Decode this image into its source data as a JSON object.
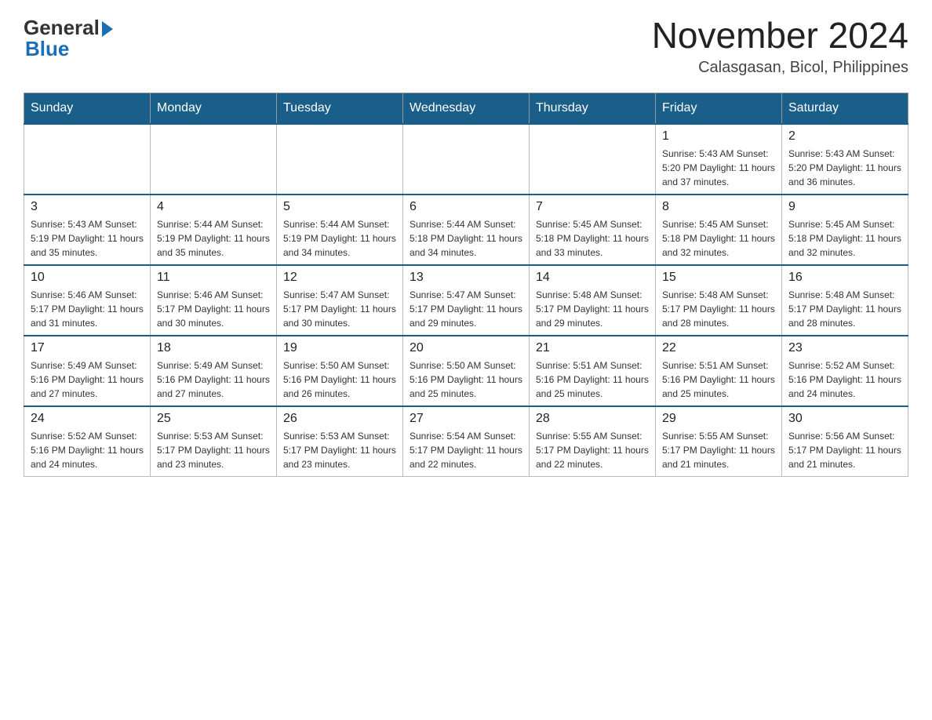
{
  "logo": {
    "general": "General",
    "blue": "Blue"
  },
  "title": "November 2024",
  "subtitle": "Calasgasan, Bicol, Philippines",
  "days_of_week": [
    "Sunday",
    "Monday",
    "Tuesday",
    "Wednesday",
    "Thursday",
    "Friday",
    "Saturday"
  ],
  "weeks": [
    [
      {
        "day": "",
        "info": ""
      },
      {
        "day": "",
        "info": ""
      },
      {
        "day": "",
        "info": ""
      },
      {
        "day": "",
        "info": ""
      },
      {
        "day": "",
        "info": ""
      },
      {
        "day": "1",
        "info": "Sunrise: 5:43 AM\nSunset: 5:20 PM\nDaylight: 11 hours and 37 minutes."
      },
      {
        "day": "2",
        "info": "Sunrise: 5:43 AM\nSunset: 5:20 PM\nDaylight: 11 hours and 36 minutes."
      }
    ],
    [
      {
        "day": "3",
        "info": "Sunrise: 5:43 AM\nSunset: 5:19 PM\nDaylight: 11 hours and 35 minutes."
      },
      {
        "day": "4",
        "info": "Sunrise: 5:44 AM\nSunset: 5:19 PM\nDaylight: 11 hours and 35 minutes."
      },
      {
        "day": "5",
        "info": "Sunrise: 5:44 AM\nSunset: 5:19 PM\nDaylight: 11 hours and 34 minutes."
      },
      {
        "day": "6",
        "info": "Sunrise: 5:44 AM\nSunset: 5:18 PM\nDaylight: 11 hours and 34 minutes."
      },
      {
        "day": "7",
        "info": "Sunrise: 5:45 AM\nSunset: 5:18 PM\nDaylight: 11 hours and 33 minutes."
      },
      {
        "day": "8",
        "info": "Sunrise: 5:45 AM\nSunset: 5:18 PM\nDaylight: 11 hours and 32 minutes."
      },
      {
        "day": "9",
        "info": "Sunrise: 5:45 AM\nSunset: 5:18 PM\nDaylight: 11 hours and 32 minutes."
      }
    ],
    [
      {
        "day": "10",
        "info": "Sunrise: 5:46 AM\nSunset: 5:17 PM\nDaylight: 11 hours and 31 minutes."
      },
      {
        "day": "11",
        "info": "Sunrise: 5:46 AM\nSunset: 5:17 PM\nDaylight: 11 hours and 30 minutes."
      },
      {
        "day": "12",
        "info": "Sunrise: 5:47 AM\nSunset: 5:17 PM\nDaylight: 11 hours and 30 minutes."
      },
      {
        "day": "13",
        "info": "Sunrise: 5:47 AM\nSunset: 5:17 PM\nDaylight: 11 hours and 29 minutes."
      },
      {
        "day": "14",
        "info": "Sunrise: 5:48 AM\nSunset: 5:17 PM\nDaylight: 11 hours and 29 minutes."
      },
      {
        "day": "15",
        "info": "Sunrise: 5:48 AM\nSunset: 5:17 PM\nDaylight: 11 hours and 28 minutes."
      },
      {
        "day": "16",
        "info": "Sunrise: 5:48 AM\nSunset: 5:17 PM\nDaylight: 11 hours and 28 minutes."
      }
    ],
    [
      {
        "day": "17",
        "info": "Sunrise: 5:49 AM\nSunset: 5:16 PM\nDaylight: 11 hours and 27 minutes."
      },
      {
        "day": "18",
        "info": "Sunrise: 5:49 AM\nSunset: 5:16 PM\nDaylight: 11 hours and 27 minutes."
      },
      {
        "day": "19",
        "info": "Sunrise: 5:50 AM\nSunset: 5:16 PM\nDaylight: 11 hours and 26 minutes."
      },
      {
        "day": "20",
        "info": "Sunrise: 5:50 AM\nSunset: 5:16 PM\nDaylight: 11 hours and 25 minutes."
      },
      {
        "day": "21",
        "info": "Sunrise: 5:51 AM\nSunset: 5:16 PM\nDaylight: 11 hours and 25 minutes."
      },
      {
        "day": "22",
        "info": "Sunrise: 5:51 AM\nSunset: 5:16 PM\nDaylight: 11 hours and 25 minutes."
      },
      {
        "day": "23",
        "info": "Sunrise: 5:52 AM\nSunset: 5:16 PM\nDaylight: 11 hours and 24 minutes."
      }
    ],
    [
      {
        "day": "24",
        "info": "Sunrise: 5:52 AM\nSunset: 5:16 PM\nDaylight: 11 hours and 24 minutes."
      },
      {
        "day": "25",
        "info": "Sunrise: 5:53 AM\nSunset: 5:17 PM\nDaylight: 11 hours and 23 minutes."
      },
      {
        "day": "26",
        "info": "Sunrise: 5:53 AM\nSunset: 5:17 PM\nDaylight: 11 hours and 23 minutes."
      },
      {
        "day": "27",
        "info": "Sunrise: 5:54 AM\nSunset: 5:17 PM\nDaylight: 11 hours and 22 minutes."
      },
      {
        "day": "28",
        "info": "Sunrise: 5:55 AM\nSunset: 5:17 PM\nDaylight: 11 hours and 22 minutes."
      },
      {
        "day": "29",
        "info": "Sunrise: 5:55 AM\nSunset: 5:17 PM\nDaylight: 11 hours and 21 minutes."
      },
      {
        "day": "30",
        "info": "Sunrise: 5:56 AM\nSunset: 5:17 PM\nDaylight: 11 hours and 21 minutes."
      }
    ]
  ]
}
